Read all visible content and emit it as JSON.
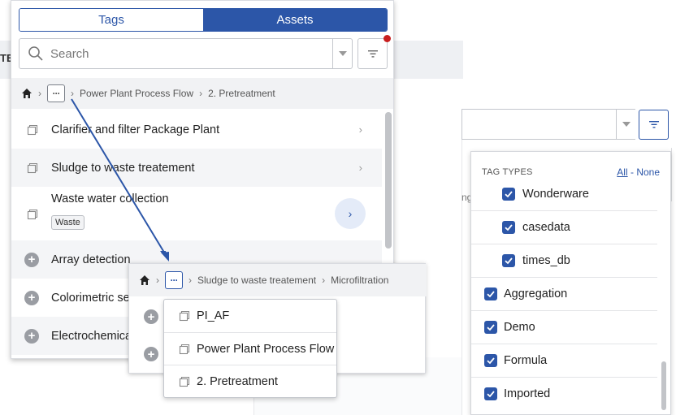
{
  "background": {
    "left_edge_text": "TE:"
  },
  "left_panel": {
    "tabs": [
      {
        "label": "Tags",
        "selected": false
      },
      {
        "label": "Assets",
        "selected": true
      }
    ],
    "search": {
      "placeholder": "Search"
    },
    "breadcrumb": {
      "items": [
        "Power Plant Process Flow",
        "2. Pretreatment"
      ]
    },
    "list": [
      {
        "label": "Clarifier and filter Package Plant",
        "icon": "asset-icon"
      },
      {
        "label": "Sludge to waste treatement",
        "icon": "asset-icon"
      },
      {
        "label": "Waste water collection",
        "icon": "asset-icon",
        "tag": "Waste"
      },
      {
        "label": "Array detection",
        "icon": "add-icon"
      },
      {
        "label": "Colorimetric ser",
        "icon": "add-icon"
      },
      {
        "label": "Electrochemica",
        "icon": "add-icon"
      }
    ]
  },
  "popup": {
    "breadcrumb": {
      "items": [
        "Sludge to waste treatement",
        "Microfiltration"
      ]
    },
    "menu": [
      {
        "label": "PI_AF",
        "icon": "asset-icon"
      },
      {
        "label": "Power Plant Process Flow",
        "icon": "asset-icon"
      },
      {
        "label": "2. Pretreatment",
        "icon": "asset-icon"
      }
    ]
  },
  "right_panel": {
    "side_fragment": "ng",
    "dropdown": {
      "title": "TAG TYPES",
      "all_label": "All",
      "separator": " - ",
      "none_label": "None",
      "options": [
        {
          "label": "Wonderware",
          "checked": true,
          "indented": true
        },
        {
          "label": "casedata",
          "checked": true,
          "indented": true
        },
        {
          "label": "times_db",
          "checked": true,
          "indented": true
        },
        {
          "label": "Aggregation",
          "checked": true,
          "indented": false
        },
        {
          "label": "Demo",
          "checked": true,
          "indented": false
        },
        {
          "label": "Formula",
          "checked": true,
          "indented": false
        },
        {
          "label": "Imported",
          "checked": true,
          "indented": false
        }
      ]
    }
  },
  "colors": {
    "accent": "#2c56a8",
    "notification_dot": "#c81e1e",
    "row_alt": "#f4f5f7"
  }
}
